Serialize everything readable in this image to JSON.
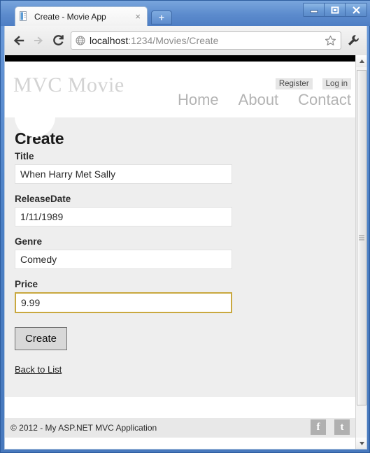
{
  "browser": {
    "tab": {
      "title": "Create - Movie App",
      "favicon_icon": "page-document-icon",
      "close_icon": "close-icon"
    },
    "new_tab_label": "+",
    "window_controls": {
      "minimize_icon": "minimize-icon",
      "maximize_icon": "maximize-icon",
      "close_icon": "close-icon"
    },
    "nav": {
      "back_icon": "back-arrow-icon",
      "forward_icon": "forward-arrow-icon",
      "reload_icon": "reload-icon"
    },
    "address_bar": {
      "site_icon": "globe-icon",
      "url_host": "localhost",
      "url_path": ":1234/Movies/Create",
      "bookmark_icon": "star-icon"
    },
    "menu_icon": "wrench-icon",
    "scrollbar": {
      "up_arrow_icon": "scroll-up-arrow-icon",
      "down_arrow_icon": "scroll-down-arrow-icon"
    }
  },
  "site": {
    "brand": "MVC Movie",
    "auth_links": [
      {
        "label": "Register"
      },
      {
        "label": "Log in"
      }
    ],
    "nav_links": [
      {
        "label": "Home"
      },
      {
        "label": "About"
      },
      {
        "label": "Contact"
      }
    ]
  },
  "main": {
    "title": "Create",
    "fields": [
      {
        "label": "Title",
        "value": "When Harry Met Sally",
        "focused": false
      },
      {
        "label": "ReleaseDate",
        "value": "1/11/1989",
        "focused": false
      },
      {
        "label": "Genre",
        "value": "Comedy",
        "focused": false
      },
      {
        "label": "Price",
        "value": "9.99",
        "focused": true
      }
    ],
    "submit_label": "Create",
    "back_link_label": "Back to List"
  },
  "footer": {
    "copyright": "© 2012 - My ASP.NET MVC Application",
    "social": [
      {
        "glyph": "f",
        "name": "facebook-icon"
      },
      {
        "glyph": "t",
        "name": "twitter-icon"
      }
    ]
  },
  "colors": {
    "focus_border": "#c9a83f",
    "brand_text": "#d3d3d3",
    "page_bg": "#eeeeee",
    "chrome_blue": "#4a7fc4"
  }
}
